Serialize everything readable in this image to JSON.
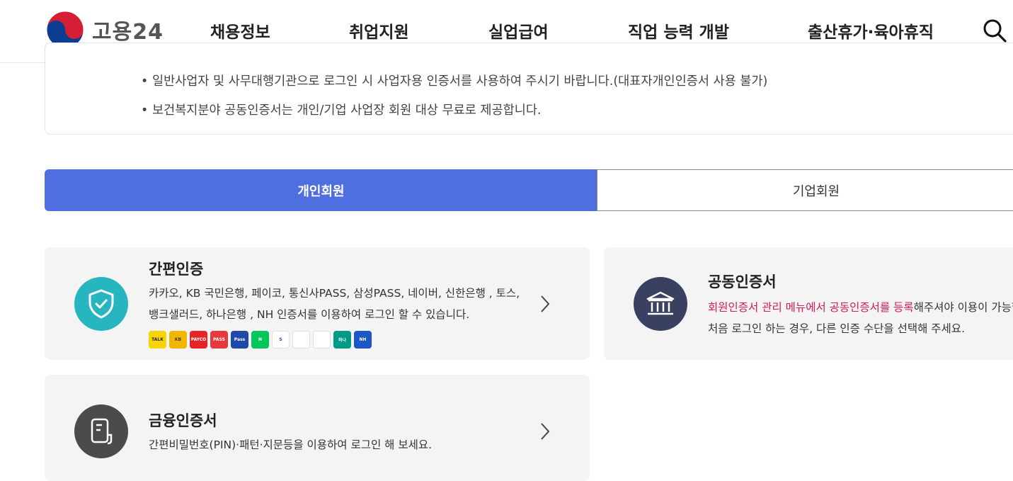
{
  "header": {
    "logo_text": "고용24",
    "nav": [
      "채용정보",
      "취업지원",
      "실업급여",
      "직업 능력 개발",
      "출산휴가·육아휴직"
    ]
  },
  "notice": {
    "lines": [
      "일반사업자 및 사무대행기관으로 로그인 시 사업자용 인증서를 사용하여 주시기 바랍니다.(대표자개인인증서 사용 불가)",
      "보건복지분야 공동인증서는 개인/기업 사업장 회원 대상 무료로 제공합니다."
    ]
  },
  "tabs": {
    "personal": "개인회원",
    "business": "기업회원"
  },
  "cards": {
    "simple": {
      "title": "간편인증",
      "desc_line1": "카카오, KB 국민은행, 페이코, 통신사PASS, 삼성PASS, 네이버, 신한은행 , 토스,",
      "desc_line2": "뱅크샐러드, 하나은행 , NH 인증서를 이용하여 로그인 할 수 있습니다."
    },
    "joint": {
      "title": "공동인증서",
      "desc_highlight": "회원인증서 관리 메뉴에서 공동인증서를 등록",
      "desc_rest": "해주셔야 이용이 가능합니다.",
      "desc_line2": "처음 로그인 하는 경우, 다른 인증 수단을 선택해 주세요."
    },
    "finance": {
      "title": "금융인증서",
      "desc": "간편비밀번호(PIN)·패턴·지문등을 이용하여 로그인 해 보세요."
    }
  },
  "providers": [
    {
      "name": "kakao",
      "label": "TALK",
      "color": "#f7d600",
      "text": "#3a1d1d"
    },
    {
      "name": "kb",
      "label": "KB",
      "color": "#f2b500",
      "text": "#4a3a1d"
    },
    {
      "name": "payco",
      "label": "PAYCO",
      "color": "#e5252a",
      "text": "#ffffff"
    },
    {
      "name": "pass",
      "label": "PASS",
      "color": "#e8383d",
      "text": "#ffffff"
    },
    {
      "name": "samsung-pass",
      "label": "Pass",
      "color": "#1f4aa8",
      "text": "#ffffff"
    },
    {
      "name": "naver",
      "label": "N",
      "color": "#03c75a",
      "text": "#ffffff"
    },
    {
      "name": "shinhan",
      "label": "S",
      "color": "#ffffff",
      "text": "#1a50b8"
    },
    {
      "name": "toss",
      "label": "",
      "color": "#ffffff",
      "text": "#1a7cff"
    },
    {
      "name": "banksalad",
      "label": "",
      "color": "#ffffff",
      "text": "#2cc28b"
    },
    {
      "name": "hana",
      "label": "하나",
      "color": "#009b84",
      "text": "#ffffff"
    },
    {
      "name": "nh",
      "label": "NH",
      "color": "#1b57c5",
      "text": "#ffffff"
    }
  ],
  "colors": {
    "accent": "#4f6ee0",
    "shield": "#27b6bf",
    "bank": "#3a4160",
    "finance": "#4b4b4b",
    "highlight": "#d6175d"
  }
}
